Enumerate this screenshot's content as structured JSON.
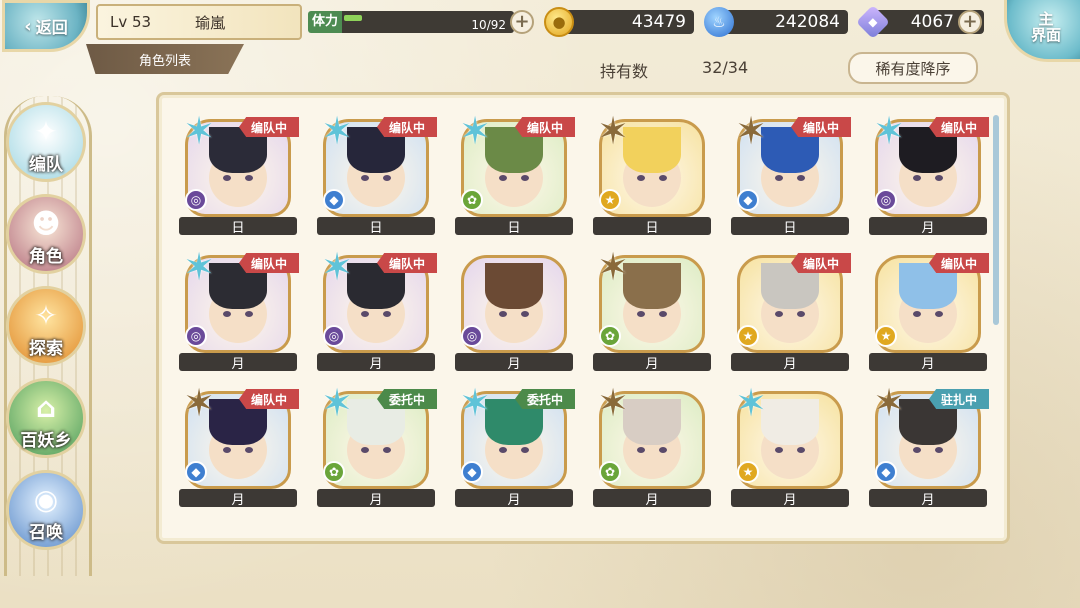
{
  "top": {
    "back_label": "返回",
    "level": "Lv 53",
    "player_name": "瑜嵐",
    "tab_title": "角色列表",
    "stamina_label": "体力",
    "stamina_value": "10/92",
    "stamina_fraction": 0.11,
    "gold": "43479",
    "soul_fire": "242084",
    "gems": "4067",
    "home_label_1": "主",
    "home_label_2": "界面"
  },
  "roster": {
    "owned_label": "持有数",
    "owned_count": "32/34",
    "sort_label": "稀有度降序"
  },
  "side_menu": [
    {
      "label": "编队",
      "glyph": "✦"
    },
    {
      "label": "角色",
      "glyph": "☻"
    },
    {
      "label": "探索",
      "glyph": "✧"
    },
    {
      "label": "百妖乡",
      "glyph": "⌂"
    },
    {
      "label": "召唤",
      "glyph": "◉"
    }
  ],
  "cards": [
    {
      "rank": "silver",
      "element": "dark",
      "status": "编队中",
      "attr": "日",
      "hair": "#2b2b38"
    },
    {
      "rank": "silver",
      "element": "water",
      "status": "编队中",
      "attr": "日",
      "hair": "#26263a"
    },
    {
      "rank": "silver",
      "element": "wind",
      "status": "编队中",
      "attr": "日",
      "hair": "#6b8a47"
    },
    {
      "rank": "gold",
      "element": "light",
      "status": "",
      "attr": "日",
      "hair": "#f2d15c"
    },
    {
      "rank": "gold",
      "element": "water",
      "status": "编队中",
      "attr": "日",
      "hair": "#2d5bb5"
    },
    {
      "rank": "silver",
      "element": "dark",
      "status": "编队中",
      "attr": "月",
      "hair": "#1e1c22"
    },
    {
      "rank": "silver",
      "element": "dark",
      "status": "编队中",
      "attr": "月",
      "hair": "#2c2c33"
    },
    {
      "rank": "silver",
      "element": "dark",
      "status": "编队中",
      "attr": "月",
      "hair": "#2a2a31"
    },
    {
      "rank": "",
      "element": "dark",
      "status": "",
      "attr": "月",
      "hair": "#6b4a34"
    },
    {
      "rank": "gold",
      "element": "wind",
      "status": "",
      "attr": "月",
      "hair": "#8a6f4b"
    },
    {
      "rank": "",
      "element": "light",
      "status": "编队中",
      "attr": "月",
      "hair": "#c9c6c0"
    },
    {
      "rank": "",
      "element": "light",
      "status": "编队中",
      "attr": "月",
      "hair": "#8fc0e8"
    },
    {
      "rank": "gold",
      "element": "water",
      "status": "编队中",
      "attr": "月",
      "hair": "#2a2446"
    },
    {
      "rank": "silver",
      "element": "wind",
      "status": "委托中",
      "attr": "月",
      "hair": "#e8ece4"
    },
    {
      "rank": "silver",
      "element": "water",
      "status": "委托中",
      "attr": "月",
      "hair": "#2f8a6a"
    },
    {
      "rank": "gold",
      "element": "wind",
      "status": "",
      "attr": "月",
      "hair": "#d8cdc4"
    },
    {
      "rank": "silver",
      "element": "light",
      "status": "",
      "attr": "月",
      "hair": "#f0ece4"
    },
    {
      "rank": "gold",
      "element": "water",
      "status": "驻扎中",
      "attr": "月",
      "hair": "#3a3634"
    }
  ],
  "colors": {
    "tag_team": "#c94848",
    "tag_commission": "#4c8a4a",
    "tag_garrison": "#4aa0b0",
    "elem_dark": "#6a4a9a",
    "elem_water": "#3f7fd0",
    "elem_wind": "#6aa53a",
    "elem_light": "#e0a820",
    "rank_silver": "#5fc3d8",
    "rank_gold": "#8a6a3a"
  }
}
